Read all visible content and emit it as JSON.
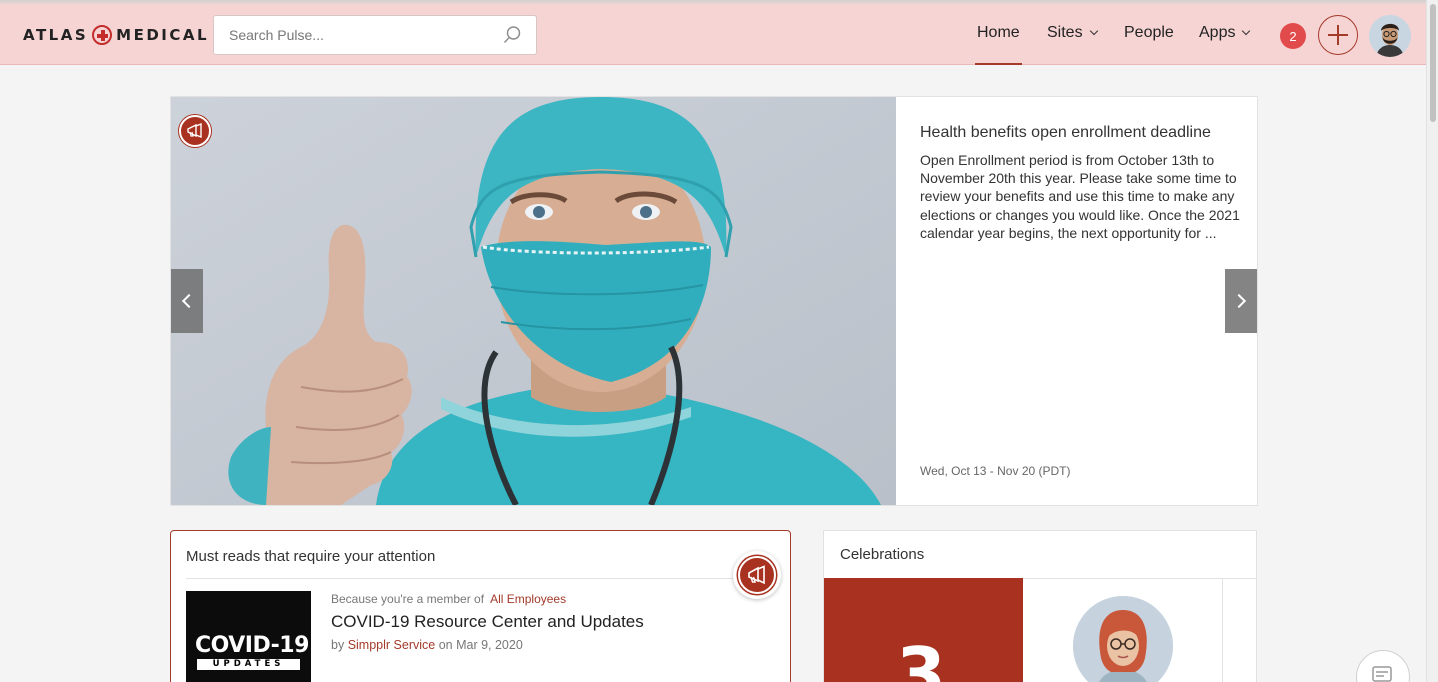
{
  "brand": {
    "name_left": "ATLAS",
    "name_right": "MEDICAL",
    "accent": "#a33a2a",
    "topbar_bg": "#f7d4d4"
  },
  "search": {
    "placeholder": "Search Pulse..."
  },
  "nav": {
    "home": "Home",
    "sites": "Sites",
    "people": "People",
    "apps": "Apps",
    "active": "Home",
    "notification_count": "2"
  },
  "carousel": {
    "title": "Health benefits open enrollment deadline",
    "body": "Open Enrollment period is from October 13th to November 20th this year. Please take some time to review your benefits and use this time to make any elections or changes you would like. Once the 2021 calendar year begins, the next opportunity for ...",
    "date": "Wed, Oct 13 - Nov 20 (PDT)"
  },
  "must_reads": {
    "heading": "Must reads that require your attention",
    "item": {
      "thumb_big": "COVID-19",
      "thumb_small": "UPDATES",
      "meta_prefix": "Because you're a member of",
      "meta_link": "All Employees",
      "title": "COVID-19 Resource Center and Updates",
      "by_prefix": "by",
      "author": "Simpplr Service",
      "date_text": "on Mar 9, 2020"
    }
  },
  "celebrations": {
    "heading": "Celebrations",
    "tile_number": "3"
  }
}
